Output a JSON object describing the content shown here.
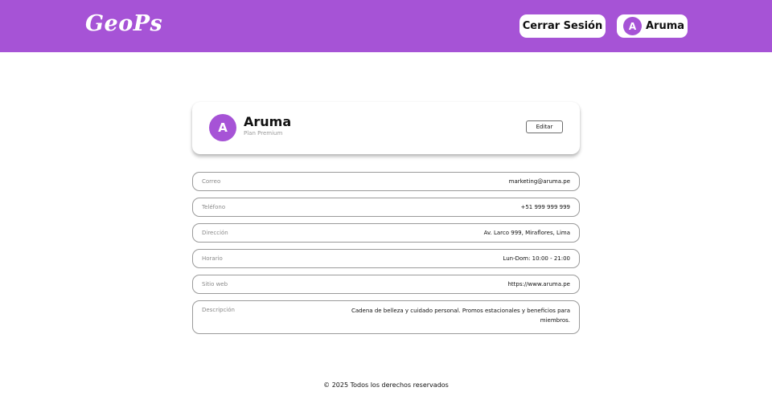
{
  "header": {
    "logo": "GeoPs",
    "logout_label": "Cerrar Sesión",
    "user_initial": "A",
    "user_name": "Aruma"
  },
  "profile": {
    "initial": "A",
    "name": "Aruma",
    "plan": "Plan Premium",
    "edit_label": "Editar"
  },
  "fields": [
    {
      "label": "Correo",
      "value": "marketing@aruma.pe"
    },
    {
      "label": "Teléfono",
      "value": "+51 999 999 999"
    },
    {
      "label": "Dirección",
      "value": "Av. Larco 999, Miraflores, Lima"
    },
    {
      "label": "Horario",
      "value": "Lun-Dom: 10:00 - 21:00"
    },
    {
      "label": "Sitio web",
      "value": "https://www.aruma.pe"
    },
    {
      "label": "Descripción",
      "value": "Cadena de belleza y cuidado personal. Promos estacionales y beneficios para miembros."
    }
  ],
  "footer": {
    "text": "© 2025 Todos los derechos reservados"
  },
  "colors": {
    "brand": "#a653d6",
    "background": "#ffffff"
  }
}
